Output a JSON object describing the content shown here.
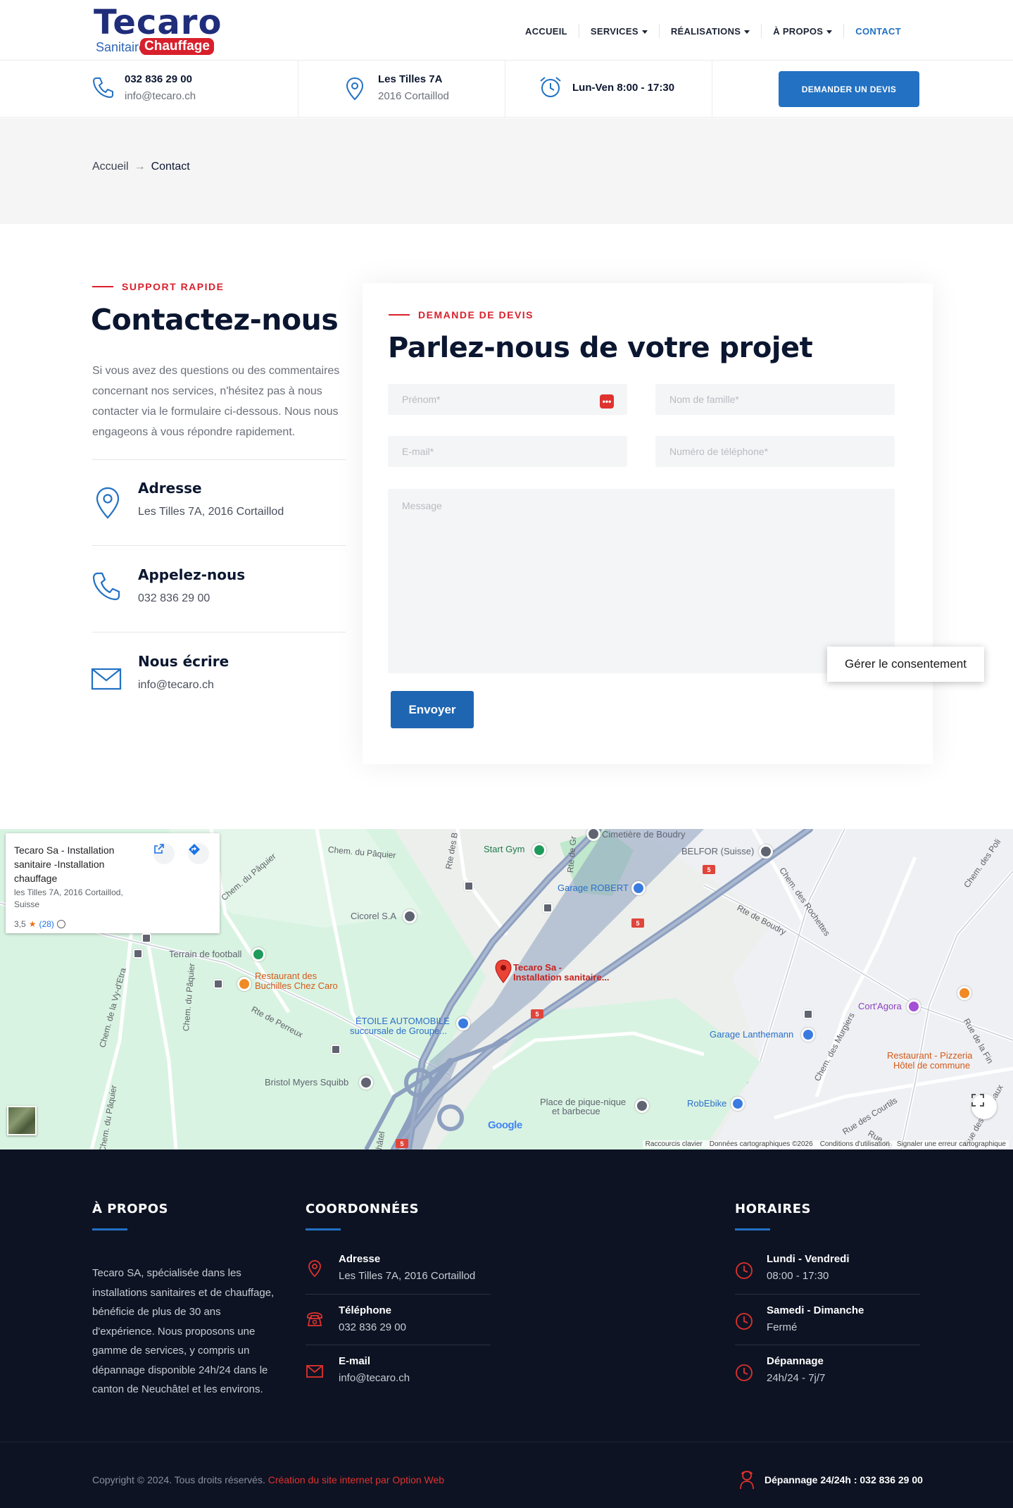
{
  "brand": {
    "name": "Tecaro",
    "sub_left": "Sanitaire",
    "sub_right": "Chauffage"
  },
  "nav": {
    "items": [
      {
        "label": "ACCUEIL"
      },
      {
        "label": "SERVICES"
      },
      {
        "label": "RÉALISATIONS"
      },
      {
        "label": "À PROPOS"
      },
      {
        "label": "CONTACT"
      }
    ]
  },
  "infobar": {
    "phone": "032 836 29 00",
    "email": "info@tecaro.ch",
    "street": "Les Tilles 7A",
    "city": "2016 Cortaillod",
    "hours": "Lun-Ven 8:00 - 17:30",
    "quote_button": "DEMANDER UN DEVIS"
  },
  "breadcrumb": {
    "home": "Accueil",
    "arrow": "→",
    "current": "Contact"
  },
  "contact": {
    "eyebrow": "SUPPORT RAPIDE",
    "title": "Contactez-nous",
    "lead": "Si vous avez des questions ou des commentaires concernant nos services, n'hésitez pas à nous contacter via le formulaire ci-dessous. Nous nous engageons à vous répondre rapidement.",
    "items": [
      {
        "title": "Adresse",
        "text": "Les Tilles 7A, 2016 Cortaillod"
      },
      {
        "title": "Appelez-nous",
        "text": "032 836 29 00"
      },
      {
        "title": "Nous écrire",
        "text": "info@tecaro.ch"
      }
    ]
  },
  "form": {
    "eyebrow": "DEMANDE DE DEVIS",
    "title": "Parlez-nous de votre projet",
    "first_name_placeholder": "Prénom*",
    "last_name_placeholder": "Nom de famille*",
    "email_placeholder": "E-mail*",
    "phone_placeholder": "Numéro de téléphone*",
    "message_placeholder": "Message",
    "submit": "Envoyer",
    "autofill_glyph": "•••"
  },
  "consent": {
    "label": "Gérer le consentement"
  },
  "map": {
    "card": {
      "title": "Tecaro Sa - Installation sanitaire -Installation chauffage",
      "address": "les Tilles 7A, 2016 Cortaillod, Suisse",
      "rating": "3,5",
      "star": "★",
      "reviews": "(28)"
    },
    "pin_label_1": "Tecaro Sa -",
    "pin_label_2": "Installation sanitaire...",
    "places": {
      "start_gym": "Start Gym",
      "cimetiere": "Cimetière de Boudry",
      "belfor": "BELFOR (Suisse)",
      "garage_robert": "Garage ROBERT",
      "cicorel": "Cicorel S.A",
      "terrain": "Terrain de football",
      "restaurant_1": "Restaurant des",
      "restaurant_2": "Buchilles Chez Caro",
      "etoile_1": "ÉTOILE AUTOMOBILE",
      "etoile_2": "succursale de Groupe...",
      "bristol": "Bristol Myers Squibb",
      "picnic_1": "Place de pique-nique",
      "picnic_2": "et barbecue",
      "robebike": "RobEbike",
      "garage_lanthemann": "Garage Lanthemann",
      "cortagora": "Cort'Agora",
      "pizzeria_1": "Restaurant - Pizzeria",
      "pizzeria_2": "Hôtel de commune"
    },
    "roads": {
      "paquier_1": "Chem. du Pâquier",
      "paquier_2": "Chem. du Pâquier",
      "paquier_3": "Chem. du Pâquier",
      "paquier_4": "Chem. du Pâquier",
      "vy_detra": "Chem. de la Vy-d'Etra",
      "perreux": "Rte de Perreux",
      "boudry": "Rte de Boudry",
      "rochettes": "Chem. des Rochettes",
      "murgiers": "Chem. des Murgiers",
      "courtils": "Rue des Courtils",
      "rte_des_b": "Rte des B",
      "rte_de_gr": "Rte de Gr",
      "chatel": "hâtel",
      "rue_de_la_fin": "Rue de la Fin",
      "chem_des_poli": "Chem. des Poli",
      "rue_de": "Rue de",
      "rue_des_chateaux": "Rue des Châteaux"
    },
    "route_number": "5",
    "google": "Google",
    "attribution": [
      "Raccourcis clavier",
      "Données cartographiques ©2026",
      "Conditions d'utilisation",
      "Signaler une erreur cartographique"
    ]
  },
  "footer": {
    "about_title": "À PROPOS",
    "about_text": "Tecaro SA, spécialisée dans les installations sanitaires et de chauffage, bénéficie de plus de 30 ans d'expérience. Nous proposons une gamme de services, y compris un dépannage disponible 24h/24 dans le canton de Neuchâtel et les environs.",
    "coords_title": "COORDONNÉES",
    "coords": [
      {
        "title": "Adresse",
        "text": "Les Tilles 7A, 2016 Cortaillod"
      },
      {
        "title": "Téléphone",
        "text": "032 836 29 00"
      },
      {
        "title": "E-mail",
        "text": "info@tecaro.ch"
      }
    ],
    "hours_title": "HORAIRES",
    "hours": [
      {
        "title": "Lundi - Vendredi",
        "text": "08:00 - 17:30"
      },
      {
        "title": "Samedi - Dimanche",
        "text": "Fermé"
      },
      {
        "title": "Dépannage",
        "text": "24h/24 - 7j/7"
      }
    ],
    "copyright": "Copyright © 2024. Tous droits réservés.",
    "credit": "Création du site internet par Option Web",
    "hotline": "Dépannage 24/24h : 032 836 29 00"
  },
  "colors": {
    "primary_blue": "#2271c3",
    "accent_red": "#d8202c",
    "navy": "#0b1630",
    "footer_bg": "#0d1323"
  }
}
